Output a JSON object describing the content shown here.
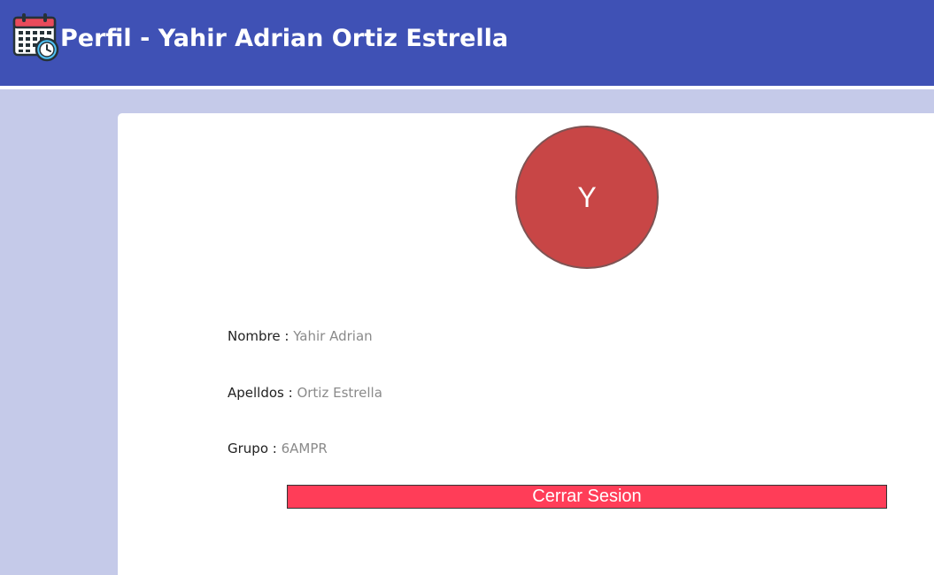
{
  "header": {
    "title": "Perfil - Yahir Adrian Ortiz Estrella",
    "icon": "calendar-clock-icon",
    "background_color": "#3f51b5"
  },
  "profile": {
    "avatar_initial": "Y",
    "avatar_color": "#c84646",
    "fields": [
      {
        "label": "Nombre : ",
        "value": "Yahir Adrian"
      },
      {
        "label": "Apelldos : ",
        "value": "Ortiz Estrella"
      },
      {
        "label": "Grupo : ",
        "value": "6AMPR"
      }
    ]
  },
  "actions": {
    "logout_label": "Cerrar Sesion",
    "logout_color": "#ff3d58"
  }
}
